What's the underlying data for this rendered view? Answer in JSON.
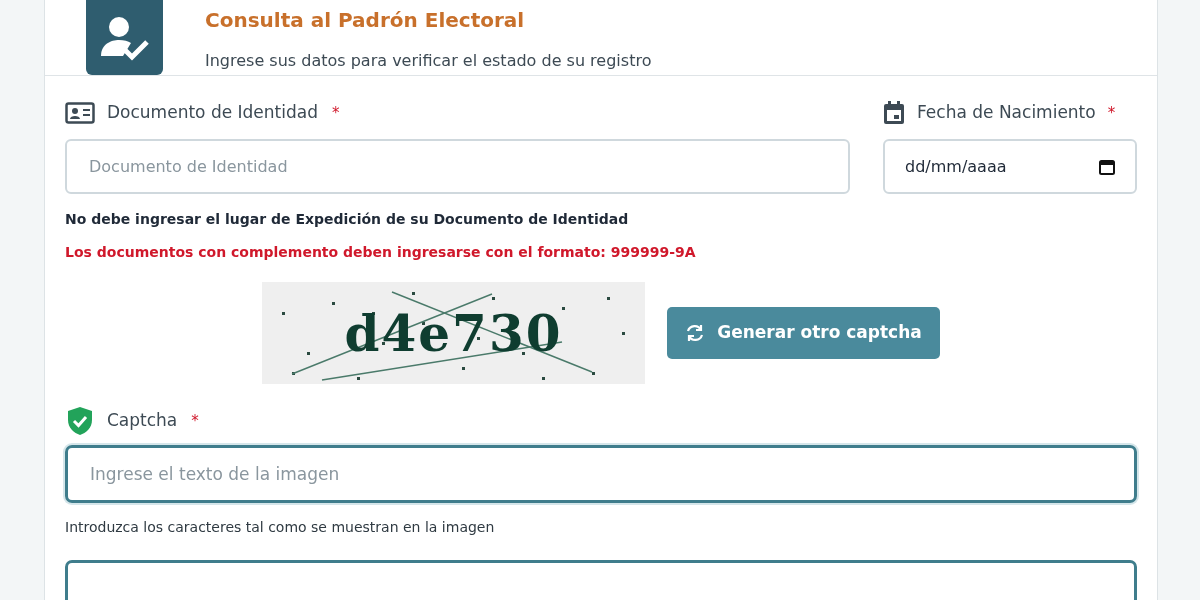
{
  "header": {
    "title": "Consulta al Padrón Electoral",
    "subtitle": "Ingrese sus datos para verificar el estado de su registro"
  },
  "document_field": {
    "label": "Documento de Identidad",
    "required_mark": "*",
    "placeholder": "Documento de Identidad"
  },
  "birthdate_field": {
    "label": "Fecha de Nacimiento",
    "required_mark": "*",
    "value": "dd/mm/aaaa"
  },
  "notes": [
    {
      "kind": "info",
      "text": "No debe ingresar el lugar de Expedición de su Documento de Identidad"
    },
    {
      "kind": "warning",
      "text": "Los documentos con complemento deben ingresarse con el formato: 999999-9A"
    }
  ],
  "captcha": {
    "image_text": "d4e730",
    "refresh_button": "Generar otro captcha",
    "label": "Captcha",
    "required_mark": "*",
    "placeholder": "Ingrese el texto de la imagen",
    "focused": true,
    "help": "Introduzca los caracteres tal como se muestran en la imagen"
  }
}
